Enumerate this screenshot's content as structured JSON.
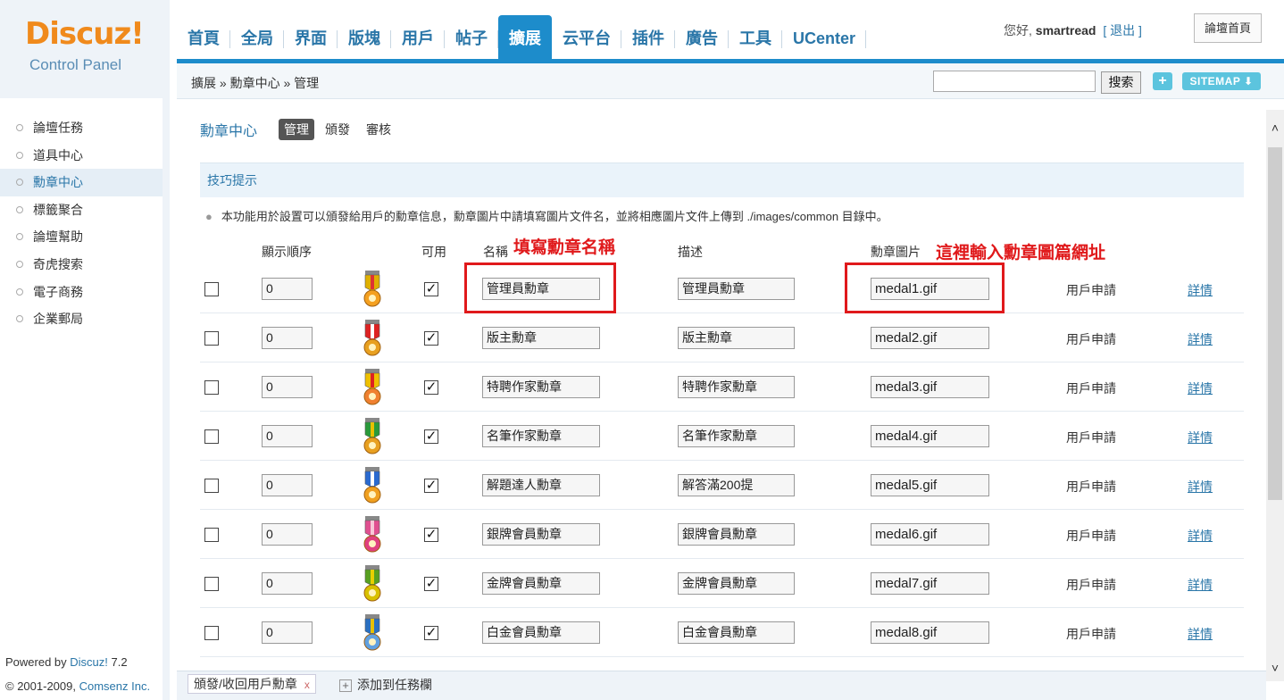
{
  "logo": {
    "brand": "Discuz!",
    "sub": "Control Panel"
  },
  "nav": {
    "tabs": [
      "首頁",
      "全局",
      "界面",
      "版塊",
      "用戶",
      "帖子",
      "擴展",
      "云平台",
      "插件",
      "廣告",
      "工具",
      "UCenter"
    ],
    "active_index": 6
  },
  "user": {
    "greeting": "您好,",
    "name": "smartread",
    "logout": "[ 退出 ]",
    "home_button": "論壇首頁"
  },
  "breadcrumb": "擴展 » 勳章中心 » 管理",
  "search": {
    "value": "",
    "button": "搜索",
    "plus": "+",
    "sitemap": "SITEMAP ⬇"
  },
  "sidebar": {
    "items": [
      "論壇任務",
      "道具中心",
      "勳章中心",
      "標籤聚合",
      "論壇幫助",
      "奇虎搜索",
      "電子商務",
      "企業郵局"
    ],
    "active_index": 2,
    "powered_prefix": "Powered by ",
    "powered_link": "Discuz!",
    "powered_version": " 7.2",
    "copyright_prefix": "© 2001-2009, ",
    "copyright_link": "Comsenz Inc."
  },
  "subhead": {
    "title": "勳章中心",
    "tabs": [
      "管理",
      "頒發",
      "審核"
    ]
  },
  "tips": {
    "title": "技巧提示",
    "text": "本功能用於設置可以頒發給用戶的勳章信息，勳章圖片中請填寫圖片文件名，並將相應圖片文件上傳到 ./images/common 目錄中。"
  },
  "columns": {
    "order": "顯示順序",
    "available": "可用",
    "name": "名稱",
    "desc": "描述",
    "image": "勳章圖片"
  },
  "medals": [
    {
      "order": "0",
      "name": "管理員勳章",
      "desc": "管理員勳章",
      "image": "medal1.gif",
      "apply": "用戶申請",
      "detail": "詳情",
      "colors": [
        "#e0b000",
        "#d33",
        "#f4a020"
      ]
    },
    {
      "order": "0",
      "name": "版主勳章",
      "desc": "版主勳章",
      "image": "medal2.gif",
      "apply": "用戶申請",
      "detail": "詳情",
      "colors": [
        "#d22",
        "#fff",
        "#e8a020"
      ]
    },
    {
      "order": "0",
      "name": "特聘作家勳章",
      "desc": "特聘作家勳章",
      "image": "medal3.gif",
      "apply": "用戶申請",
      "detail": "詳情",
      "colors": [
        "#f0c000",
        "#d22",
        "#f08030"
      ]
    },
    {
      "order": "0",
      "name": "名筆作家勳章",
      "desc": "名筆作家勳章",
      "image": "medal4.gif",
      "apply": "用戶申請",
      "detail": "詳情",
      "colors": [
        "#2a9a3a",
        "#e8c000",
        "#e8a020"
      ]
    },
    {
      "order": "0",
      "name": "解題達人勳章",
      "desc": "解答滿200提",
      "image": "medal5.gif",
      "apply": "用戶申請",
      "detail": "詳情",
      "colors": [
        "#2a6ad0",
        "#fff",
        "#f0a020"
      ]
    },
    {
      "order": "0",
      "name": "銀牌會員勳章",
      "desc": "銀牌會員勳章",
      "image": "medal6.gif",
      "apply": "用戶申請",
      "detail": "詳情",
      "colors": [
        "#e05090",
        "#f8c8d8",
        "#e04080"
      ]
    },
    {
      "order": "0",
      "name": "金牌會員勳章",
      "desc": "金牌會員勳章",
      "image": "medal7.gif",
      "apply": "用戶申請",
      "detail": "詳情",
      "colors": [
        "#58a020",
        "#e8d000",
        "#d8c000"
      ]
    },
    {
      "order": "0",
      "name": "白金會員勳章",
      "desc": "白金會員勳章",
      "image": "medal8.gif",
      "apply": "用戶申請",
      "detail": "詳情",
      "colors": [
        "#2a70c0",
        "#e8c000",
        "#60a0e0"
      ]
    }
  ],
  "annotations": {
    "name_note": "填寫勳章名稱",
    "image_note": "這裡輸入勳章圖篇網址"
  },
  "taskbar": {
    "task": "頒發/收回用戶勳章",
    "close": "x",
    "add": "添加到任務欄"
  },
  "colors": {
    "accent": "#1d8ccb",
    "link": "#2a76a8",
    "annotation": "#e0191b",
    "logo_orange": "#f08a1c"
  }
}
